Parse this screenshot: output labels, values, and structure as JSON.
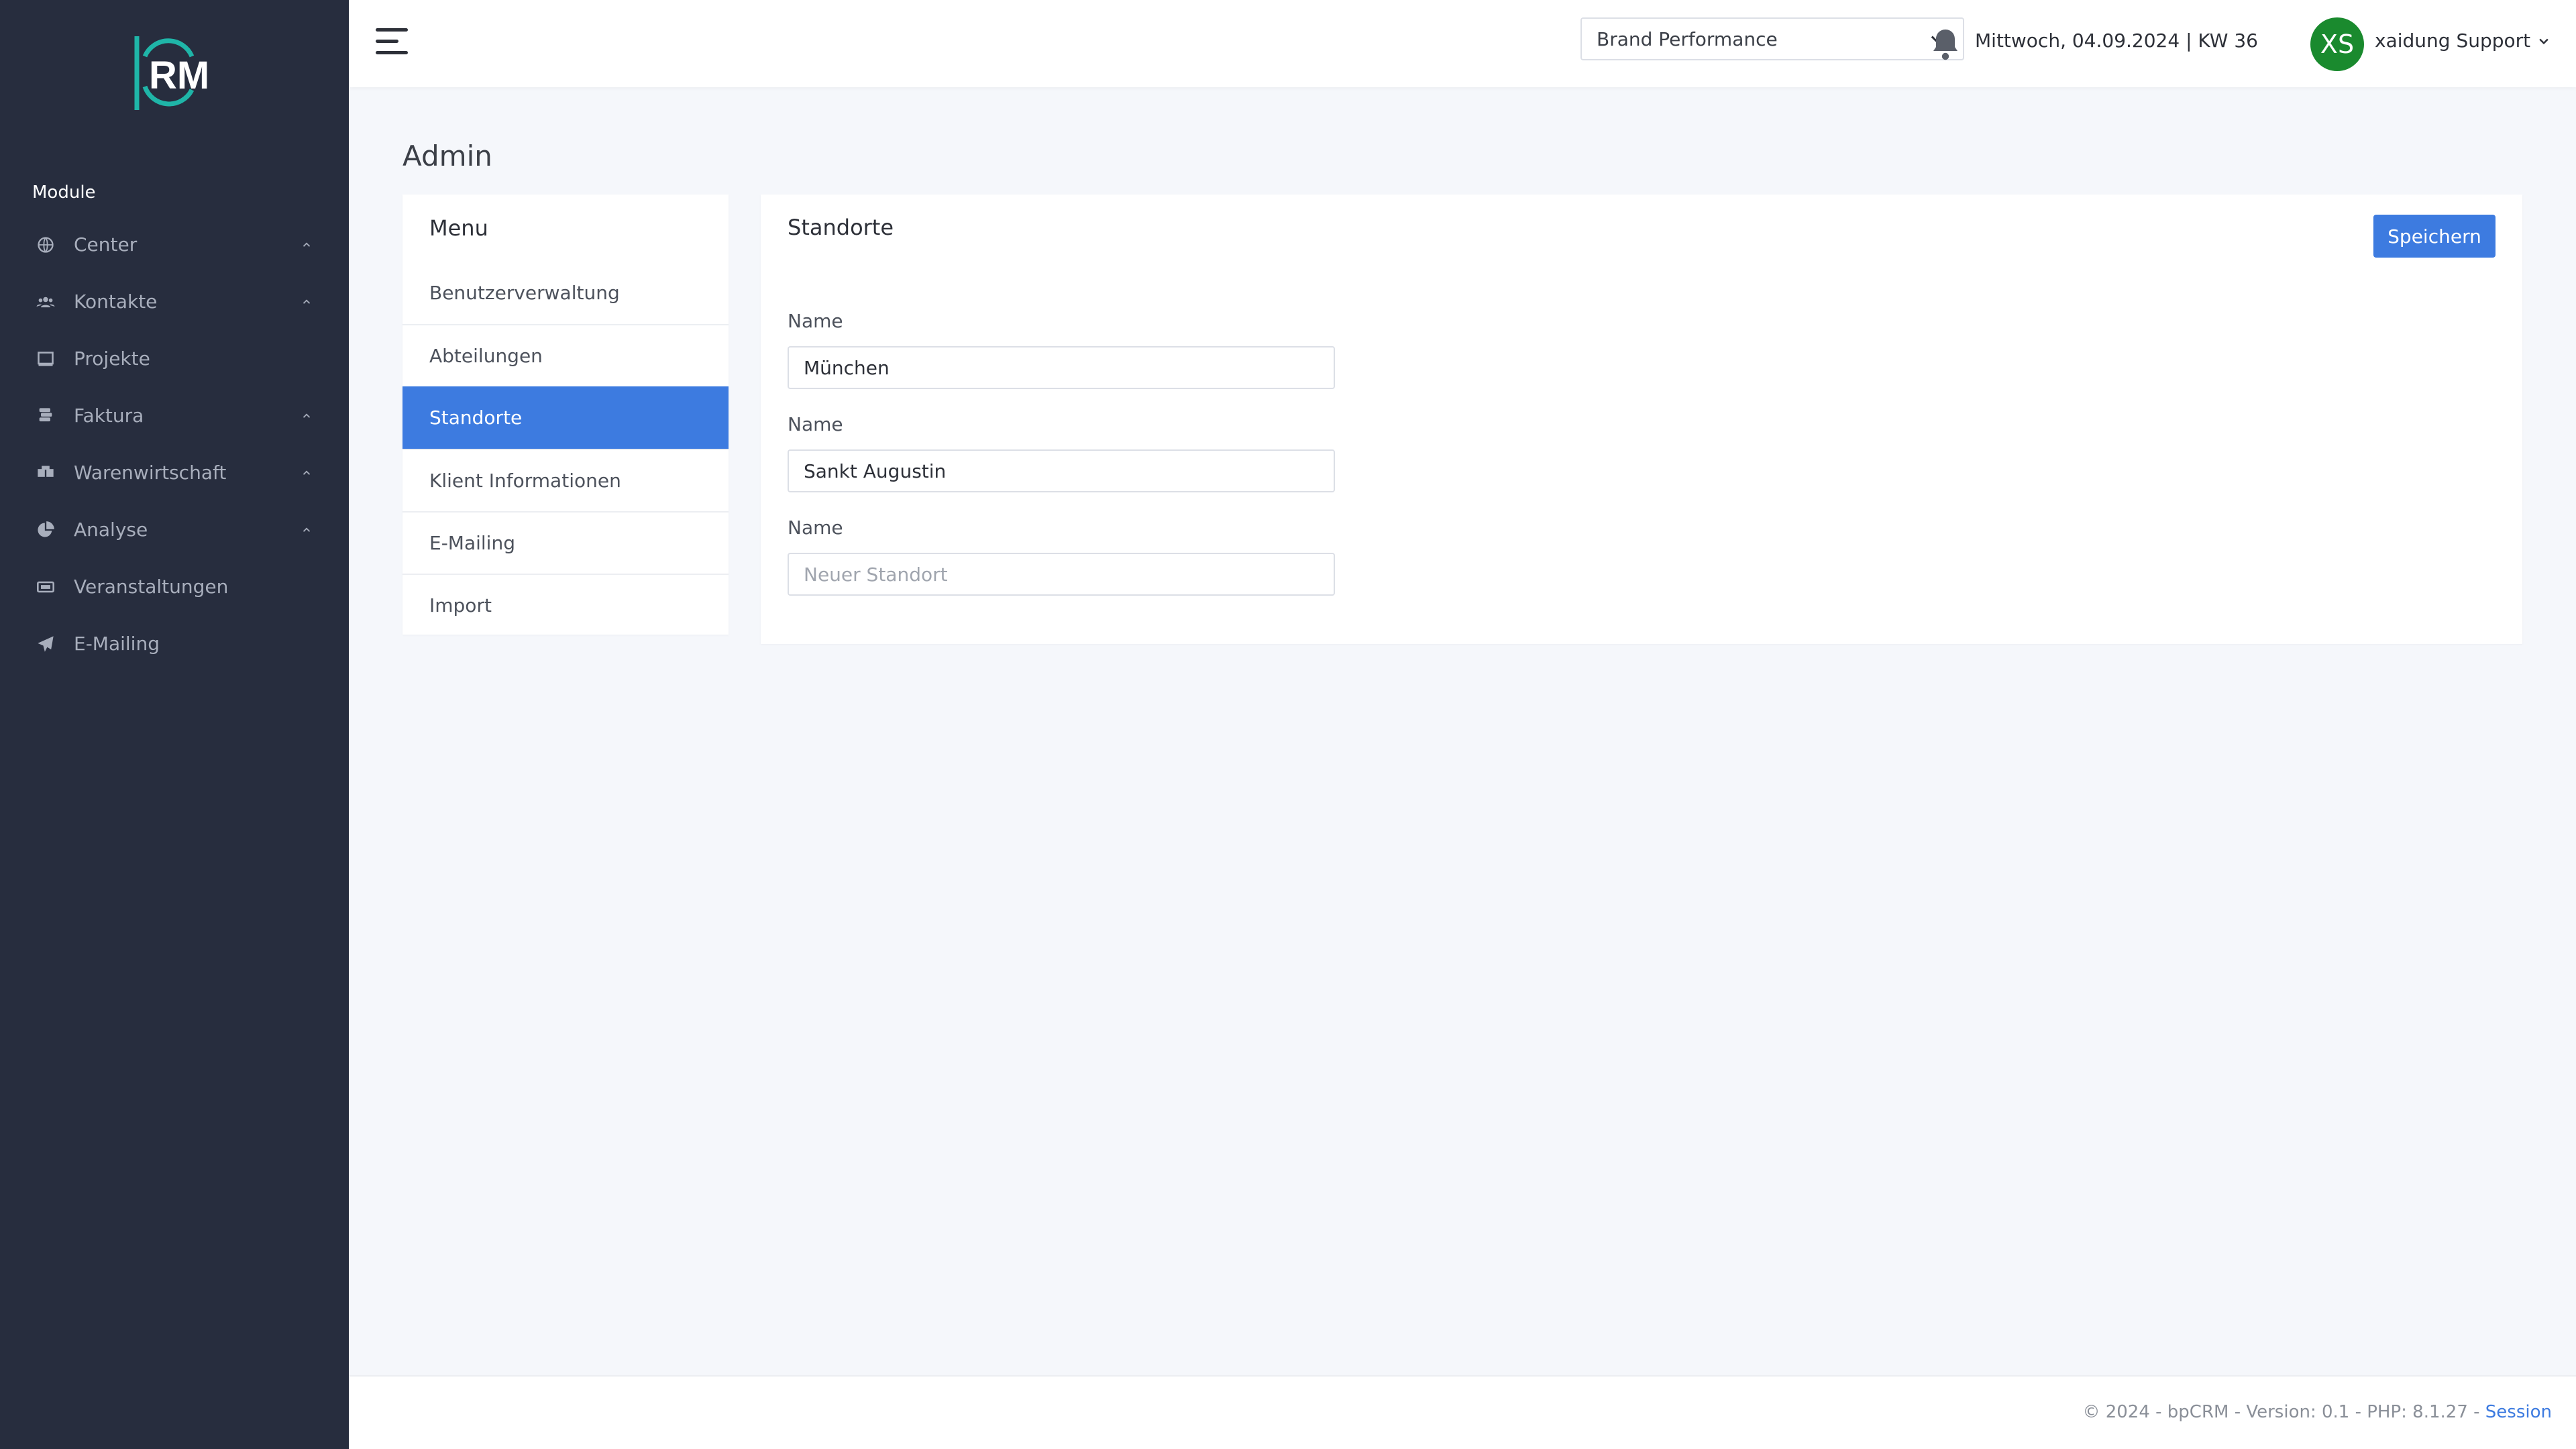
{
  "sidebar": {
    "logo_text": "RM",
    "section_label": "Module",
    "items": [
      {
        "label": "Center",
        "icon": "globe-icon",
        "has_chevron": true
      },
      {
        "label": "Kontakte",
        "icon": "users-icon",
        "has_chevron": true
      },
      {
        "label": "Projekte",
        "icon": "book-icon",
        "has_chevron": false
      },
      {
        "label": "Faktura",
        "icon": "coins-icon",
        "has_chevron": true
      },
      {
        "label": "Warenwirtschaft",
        "icon": "boxes-icon",
        "has_chevron": true
      },
      {
        "label": "Analyse",
        "icon": "pie-chart-icon",
        "has_chevron": true
      },
      {
        "label": "Veranstaltungen",
        "icon": "ticket-icon",
        "has_chevron": false
      },
      {
        "label": "E-Mailing",
        "icon": "paper-plane-icon",
        "has_chevron": false
      }
    ]
  },
  "topbar": {
    "company_select": "Brand Performance",
    "date": "Mittwoch, 04.09.2024 | KW 36",
    "avatar_initials": "XS",
    "user_name": "xaidung Support"
  },
  "page": {
    "title": "Admin"
  },
  "menu": {
    "title": "Menu",
    "items": [
      {
        "label": "Benutzerverwaltung"
      },
      {
        "label": "Abteilungen"
      },
      {
        "label": "Standorte"
      },
      {
        "label": "Klient Informationen"
      },
      {
        "label": "E-Mailing"
      },
      {
        "label": "Import"
      }
    ],
    "active": "Standorte"
  },
  "content": {
    "title": "Standorte",
    "save_label": "Speichern",
    "fields": [
      {
        "label": "Name",
        "value": "München",
        "placeholder": ""
      },
      {
        "label": "Name",
        "value": "Sankt Augustin",
        "placeholder": ""
      },
      {
        "label": "Name",
        "value": "",
        "placeholder": "Neuer Standort"
      }
    ]
  },
  "footer": {
    "text": "© 2024 - bpCRM - Version: 0.1 - PHP: 8.1.27 -",
    "link": "Session"
  },
  "colors": {
    "sidebar_bg": "#272d3e",
    "accent": "#3d7be0",
    "logo_teal": "#1fb5a8",
    "avatar_bg": "#1a8a2e"
  }
}
